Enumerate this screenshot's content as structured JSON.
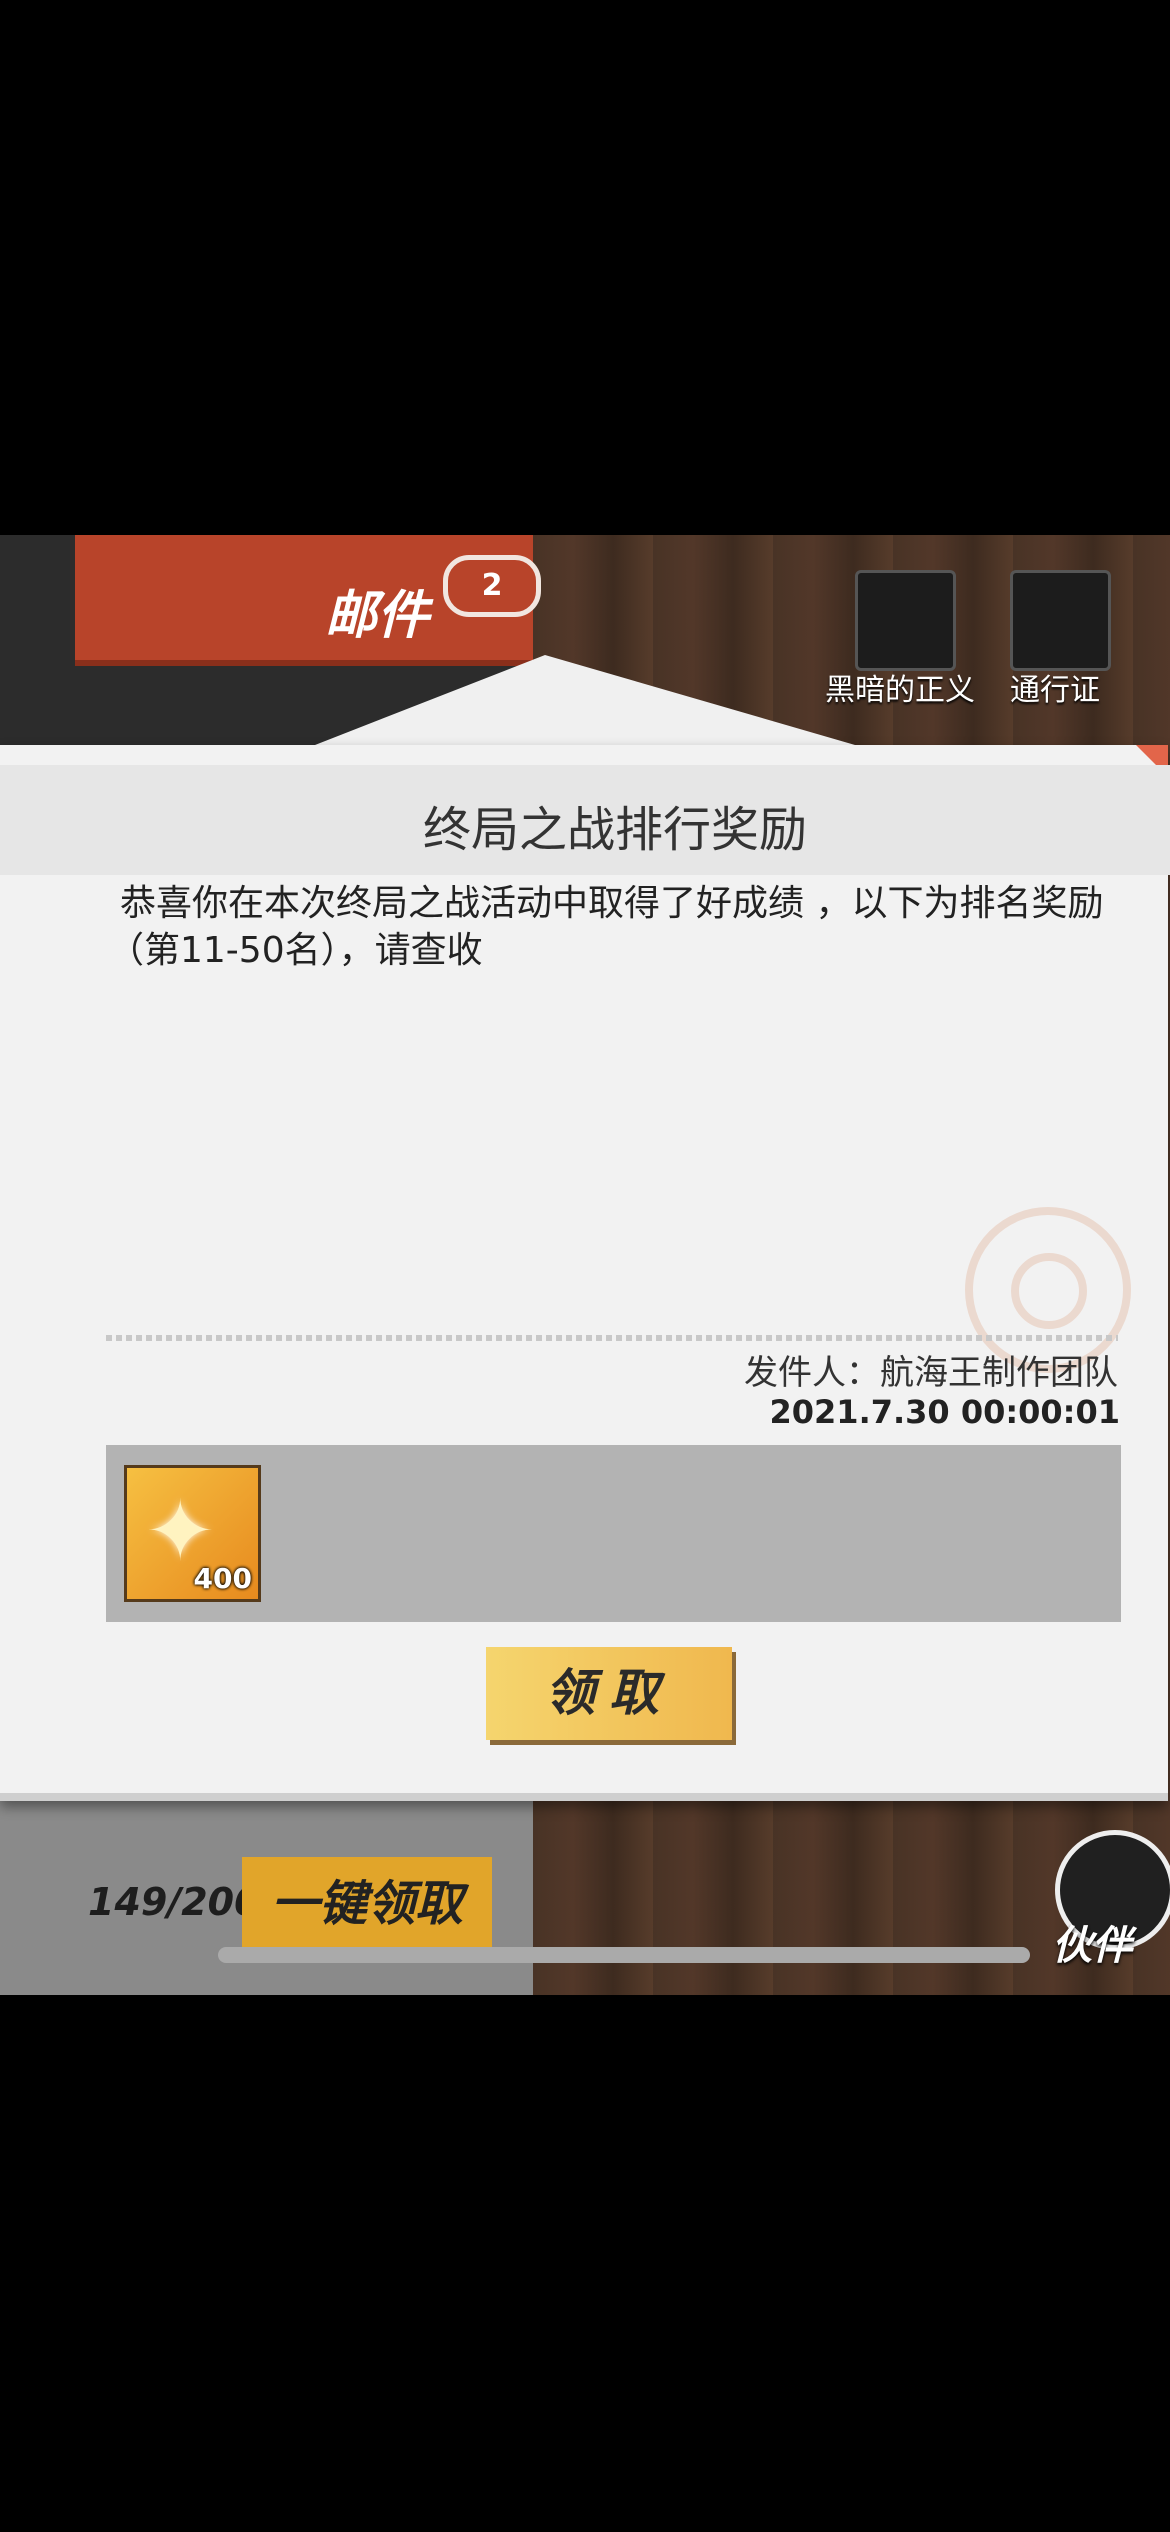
{
  "header": {
    "mail_tab_label": "邮件",
    "mail_badge_count": "2",
    "icons": [
      {
        "name": "dark-justice-icon",
        "label": "黑暗的正义"
      },
      {
        "name": "pass-icon",
        "label": "通行证"
      }
    ]
  },
  "dialog": {
    "title": "终局之战排行奖励",
    "message": "恭喜你在本次终局之战活动中取得了好成绩 ，以下为排名奖励（第11-50名），请查收",
    "sender": "发件人：航海王制作团队",
    "date": "2021.7.30 00:00:01",
    "reward": {
      "icon": "star-shard-icon",
      "quantity": "400"
    },
    "claim_label": "领取"
  },
  "footer": {
    "mail_count": "149/200",
    "claim_all_label": "一键领取",
    "partner_label": "伙伴"
  }
}
